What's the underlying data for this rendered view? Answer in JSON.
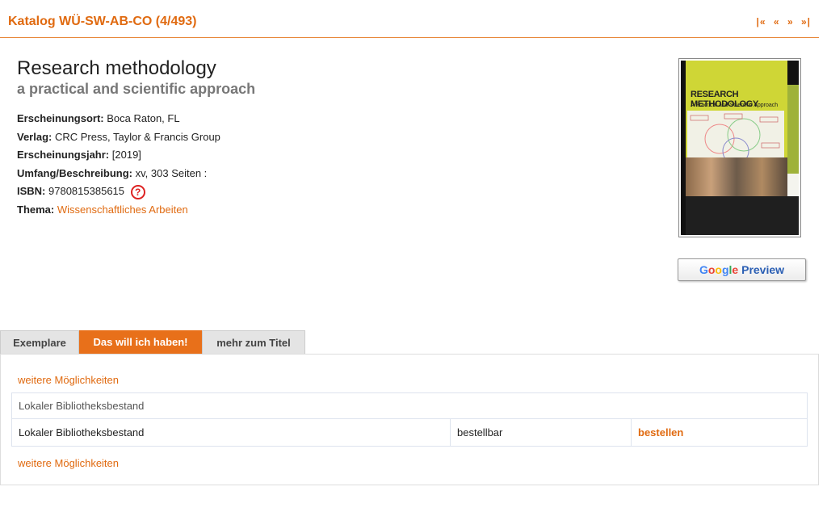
{
  "header": {
    "catalog_title": "Katalog WÜ-SW-AB-CO (4/493)",
    "pager": {
      "first": "|«",
      "prev": "«",
      "next": "»",
      "last": "»|"
    }
  },
  "record": {
    "title": "Research methodology",
    "subtitle": "a practical and scientific approach",
    "fields": {
      "ort_label": "Erscheinungsort:",
      "ort_value": "Boca Raton, FL",
      "verlag_label": "Verlag:",
      "verlag_value": "CRC Press, Taylor & Francis Group",
      "jahr_label": "Erscheinungsjahr:",
      "jahr_value": "[2019]",
      "umfang_label": "Umfang/Beschreibung:",
      "umfang_value": "xv, 303 Seiten :",
      "isbn_label": "ISBN:",
      "isbn_value": "9780815385615",
      "thema_label": "Thema:",
      "thema_value": "Wissenschaftliches Arbeiten"
    }
  },
  "cover": {
    "title": "RESEARCH METHODOLOGY",
    "subtitle": "A Practical and Scientific Approach"
  },
  "google_preview": {
    "g1": "G",
    "g2": "o",
    "g3": "o",
    "g4": "g",
    "g5": "l",
    "g6": "e",
    "label": "Preview"
  },
  "tabs": [
    {
      "label": "Exemplare",
      "active": false
    },
    {
      "label": "Das will ich haben!",
      "active": true
    },
    {
      "label": "mehr zum Titel",
      "active": false
    }
  ],
  "panel": {
    "more_link": "weitere Möglichkeiten",
    "bestand_header": "Lokaler Bibliotheksbestand",
    "row": {
      "name": "Lokaler Bibliotheksbestand",
      "status": "bestellbar",
      "action": "bestellen"
    }
  },
  "colors": {
    "accent": "#e06a10",
    "tab_active": "#e8701a"
  }
}
